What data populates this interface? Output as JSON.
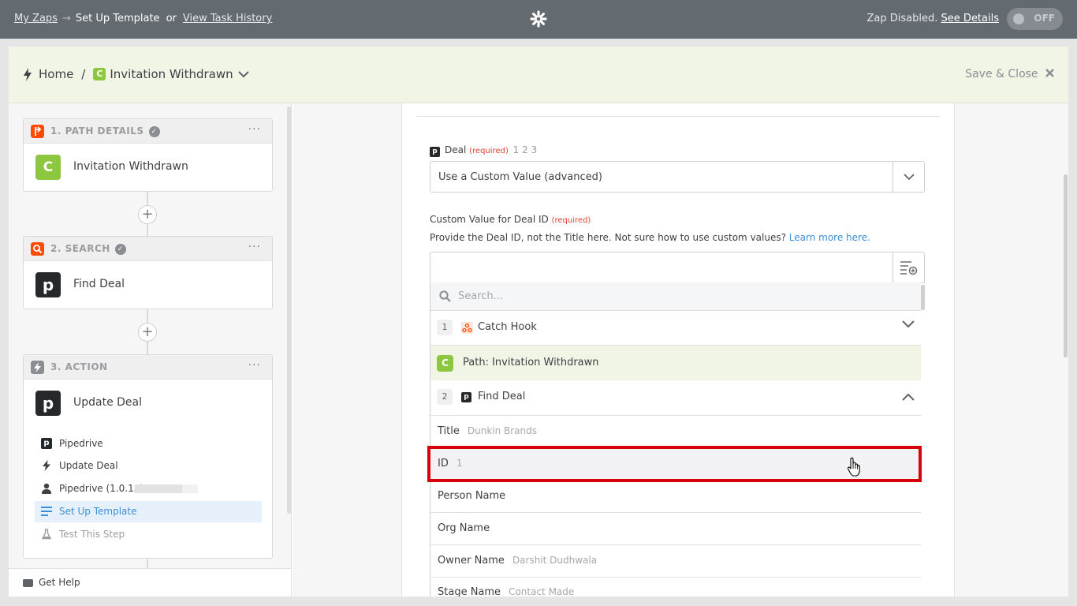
{
  "topbar": {
    "my_zaps": "My Zaps",
    "arrow": "→",
    "current": "Set Up Template",
    "or": "or",
    "task_history": "View Task History",
    "status_text": "Zap Disabled.",
    "see_details": "See Details",
    "toggle_label": "OFF"
  },
  "header": {
    "home": "Home",
    "sep": "/",
    "path_badge": "C",
    "path_name": "Invitation Withdrawn",
    "save_close": "Save & Close"
  },
  "sidebar": {
    "step1": {
      "title": "1. PATH DETAILS",
      "badge": "C",
      "name": "Invitation Withdrawn",
      "dots": "···"
    },
    "step2": {
      "title": "2. SEARCH",
      "logo": "p",
      "name": "Find Deal",
      "dots": "···"
    },
    "step3": {
      "title": "3. ACTION",
      "logo": "p",
      "name": "Update Deal",
      "dots": "···",
      "items": [
        {
          "label": "Pipedrive",
          "icon": "pipedrive-icon"
        },
        {
          "label": "Update Deal",
          "icon": "bolt-icon"
        },
        {
          "label": "Pipedrive (1.0.15)",
          "icon": "user-icon"
        },
        {
          "label": "Set Up Template",
          "icon": "lines-icon"
        },
        {
          "label": "Test This Step",
          "icon": "flask-icon"
        }
      ]
    },
    "plus": "+",
    "get_help": "Get Help"
  },
  "form": {
    "deal_logo": "p",
    "deal_label": "Deal",
    "required": "(required)",
    "deal_steps": "1 2 3",
    "deal_value": "Use a Custom Value (advanced)",
    "custom_label": "Custom Value for Deal ID",
    "help_text": "Provide the Deal ID, not the Title here. Not sure how to use custom values?",
    "learn_more": "Learn more here.",
    "search_placeholder": "Search..."
  },
  "dropdown": {
    "group1": {
      "num": "1",
      "name": "Catch Hook"
    },
    "path_row": {
      "badge": "C",
      "name": "Path: Invitation Withdrawn"
    },
    "group2": {
      "num": "2",
      "logo": "p",
      "name": "Find Deal"
    },
    "fields": [
      {
        "key": "Title",
        "value": "Dunkin Brands"
      },
      {
        "key": "ID",
        "value": "1"
      },
      {
        "key": "Person Name",
        "value": ""
      },
      {
        "key": "Org Name",
        "value": ""
      },
      {
        "key": "Owner Name",
        "value": "Darshit Dudhwala"
      },
      {
        "key": "Stage Name",
        "value": "Contact Made"
      }
    ]
  },
  "colors": {
    "topbar": "#636a70",
    "header_bg": "#f1f5e6",
    "path_green": "#8dc63f",
    "zapier_orange": "#ff4a00",
    "link_blue": "#3b8fd9",
    "required_red": "#e0422f",
    "highlight_red": "#d9000d"
  }
}
